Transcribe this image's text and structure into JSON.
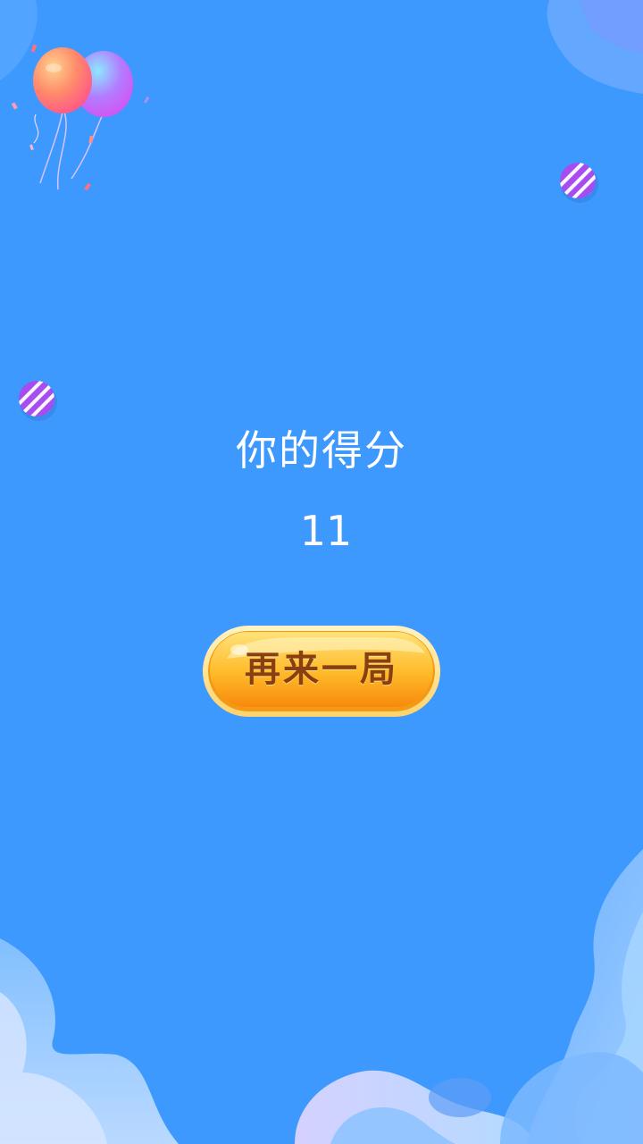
{
  "result": {
    "title": "你的得分",
    "score": "11"
  },
  "actions": {
    "replay_label": "再来一局"
  },
  "colors": {
    "background": "#3d99fd",
    "button_fill": "#ffb21e",
    "button_text": "#8a3f10",
    "text": "#ffffff"
  },
  "decorations": {
    "icons": [
      "balloons-icon",
      "striped-ball-icon",
      "wave-pattern"
    ]
  }
}
